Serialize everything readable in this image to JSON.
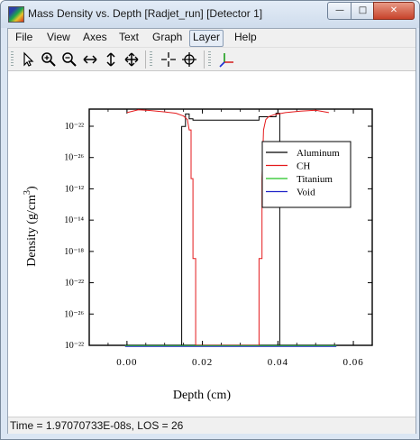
{
  "window": {
    "title": "Mass Density vs. Depth [Radjet_run] [Detector 1]",
    "buttons": {
      "minimize": "—",
      "maximize": "□",
      "close": "✕"
    }
  },
  "menu": [
    "File",
    "View",
    "Axes",
    "Text",
    "Graph",
    "Layer",
    "Help"
  ],
  "menu_active": "Layer",
  "toolbar": {
    "icons": [
      "pointer-icon",
      "zoom-in-icon",
      "zoom-out-icon",
      "pan-horizontal-icon",
      "pan-vertical-icon",
      "pan-all-icon",
      "crosshair-icon",
      "crosshair-circle-icon",
      "axes-icon"
    ]
  },
  "status": "Time = 1.97070733E-08s, LOS = 26",
  "chart_data": {
    "type": "line",
    "xlabel": "Depth (cm)",
    "ylabel": "Density (g/cm³)",
    "ylabel_base": "Density (g/cm",
    "ylabel_sup": "3",
    "ylabel_close": ")",
    "xlim": [
      -0.01,
      0.065
    ],
    "xticks": [
      "0.00",
      "0.02",
      "0.04",
      "0.06"
    ],
    "xtick_values": [
      0.0,
      0.02,
      0.04,
      0.06
    ],
    "yticks": [
      "10⁻²²",
      "10⁻²⁶",
      "10⁻¹²",
      "10⁻¹⁴",
      "10⁻¹⁸",
      "10⁻²²",
      "10⁻²⁶",
      "10⁻²²"
    ],
    "yscale": "log",
    "ylim_log10": [
      -33,
      1
    ],
    "grid": false,
    "legend_position": "upper-right",
    "series": [
      {
        "name": "Aluminum",
        "color": "#000000",
        "x": [
          -0.0005,
          0.0145,
          0.0145,
          0.0155,
          0.0155,
          0.0165,
          0.0165,
          0.0175,
          0.0175,
          0.035,
          0.035,
          0.0395,
          0.0395,
          0.0405,
          0.0405,
          0.0555
        ],
        "log10_y": [
          -33,
          -33,
          -1.5,
          -1.5,
          0.3,
          0.3,
          -0.4,
          -0.4,
          -0.6,
          -0.6,
          -0.1,
          -0.1,
          0.4,
          0.4,
          -33,
          -33
        ]
      },
      {
        "name": "CH",
        "color": "#e41a1c",
        "x": [
          0.0,
          0.003,
          0.006,
          0.01,
          0.013,
          0.015,
          0.016,
          0.0165,
          0.017,
          0.017,
          0.0175,
          0.0175,
          0.0182,
          0.0182,
          0.035,
          0.035,
          0.0358,
          0.0358,
          0.0362,
          0.0368,
          0.0375,
          0.039,
          0.042,
          0.046,
          0.05,
          0.0535
        ],
        "log10_y": [
          0.5,
          0.9,
          0.8,
          0.6,
          0.4,
          0.0,
          -0.5,
          -2.0,
          -2.0,
          -9.0,
          -9.0,
          -20.5,
          -20.5,
          -33,
          -33,
          -20.5,
          -20.5,
          -9.0,
          -2.0,
          -0.5,
          -0.1,
          0.2,
          0.5,
          0.7,
          0.85,
          0.5
        ]
      },
      {
        "name": "Titanium",
        "color": "#22c322",
        "x": [
          -0.0005,
          0.0555
        ],
        "log10_y": [
          -33.05,
          -33.05
        ]
      },
      {
        "name": "Void",
        "color": "#1f22c8",
        "x": [
          -0.0005,
          0.0555
        ],
        "log10_y": [
          -33.15,
          -33.15
        ]
      }
    ]
  }
}
